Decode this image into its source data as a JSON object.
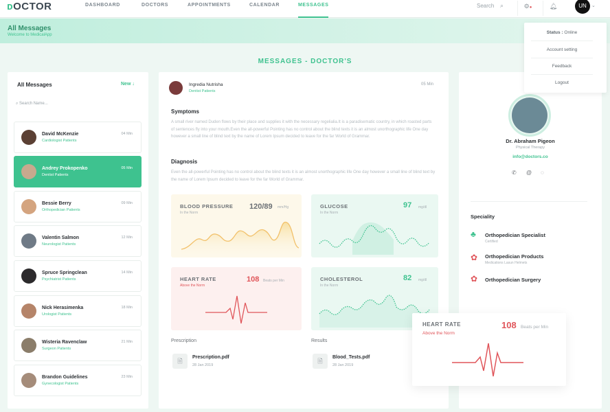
{
  "app": {
    "logo": "OCTOR"
  },
  "nav": [
    "DASHBOARD",
    "DOCTORS",
    "APPOINTMENTS",
    "CALENDAR",
    "MESSAGES"
  ],
  "search_label": "Search",
  "user_menu": {
    "status_label": "Status :",
    "status_value": "Online",
    "items": [
      "Account setting",
      "Feedback",
      "Logout"
    ]
  },
  "hero": {
    "title": "All Messages",
    "subtitle": "Welcome to MedicalApp"
  },
  "section_title": "MESSAGES - DOCTOR'S",
  "messages_panel": {
    "title": "All Messages",
    "new_label": "New",
    "search_placeholder": "Search Name...",
    "contacts": [
      {
        "name": "David McKenzie",
        "specialty": "Cardiologist Patients",
        "time": "04 Min"
      },
      {
        "name": "Andrey Prokopenko",
        "specialty": "Dentist Patients",
        "time": "05 Min"
      },
      {
        "name": "Bessie Berry",
        "specialty": "Orthopedician Patients",
        "time": "09 Min"
      },
      {
        "name": "Valentin Salmon",
        "specialty": "Neurologist Patients",
        "time": "12 Min"
      },
      {
        "name": "Spruce Springclean",
        "specialty": "Psychiatrist Patients",
        "time": "14 Min"
      },
      {
        "name": "Nick Herasimenka",
        "specialty": "Urologist Patients",
        "time": "18 Min"
      },
      {
        "name": "Wisteria Ravenclaw",
        "specialty": "Surgeon Patients",
        "time": "21 Min"
      },
      {
        "name": "Brandon Guidelines",
        "specialty": "Gynecologist Patients",
        "time": "23 Min"
      }
    ]
  },
  "conversation": {
    "name": "Ingredia Nutrisha",
    "specialty": "Dentist Patients",
    "time": "05 Min",
    "symptoms_title": "Symptoms",
    "symptoms_text": "A small river named Duden flows by their place and supplies it with the necessary regelialia.It is a paradisematic country, in which roasted parts of sentences fly into your mouth.Even the all-powerful Pointing has no control about the blind texts it is an almost unorthographic life One day however a small line of blind text by the name of Lorem Ipsum decided to leave for the far World of Grammar.",
    "diagnosis_title": "Diagnosis",
    "diagnosis_text": "Even the all-powerful Pointing has no control about the blind texts it is an almost unorthographic life One day however a small line of blind text by the name of Lorem Ipsum decided to leave for the far World of Grammar.",
    "vitals": [
      {
        "label": "BLOOD PRESSURE",
        "status": "In the Norm",
        "value": "120/89",
        "unit": "mm/Hg"
      },
      {
        "label": "GLUCOSE",
        "status": "In the Norm",
        "value": "97",
        "unit": "mg/dl"
      },
      {
        "label": "HEART RATE",
        "status": "Above the Norm",
        "value": "108",
        "unit": "Beats per Min"
      },
      {
        "label": "CHOLESTEROL",
        "status": "In the Norm",
        "value": "82",
        "unit": "mg/dl"
      }
    ],
    "prescription_label": "Prescription",
    "results_label": "Results",
    "files": [
      {
        "name": "Prescription.pdf",
        "date": "28 Jan 2019"
      },
      {
        "name": "Blood_Tests.pdf",
        "date": "28 Jan 2019"
      }
    ]
  },
  "doctor": {
    "name": "Dr. Abraham Pigeon",
    "role": "Physical Therapy",
    "email": "info@doctors.co",
    "speciality_title": "Speciality",
    "specialities": [
      {
        "name": "Orthopedician Specialist",
        "sub": "Certified"
      },
      {
        "name": "Orthopedician Products",
        "sub": "Medications Lasun Helmets"
      },
      {
        "name": "Orthopedician Surgery",
        "sub": ""
      }
    ]
  },
  "floating_heart_rate": {
    "label": "HEART RATE",
    "status": "Above the Norm",
    "value": "108",
    "unit": "Beats per Min"
  },
  "colors": {
    "accent": "#3ec28f",
    "danger": "#e0555a",
    "warm": "#f2c16b"
  }
}
